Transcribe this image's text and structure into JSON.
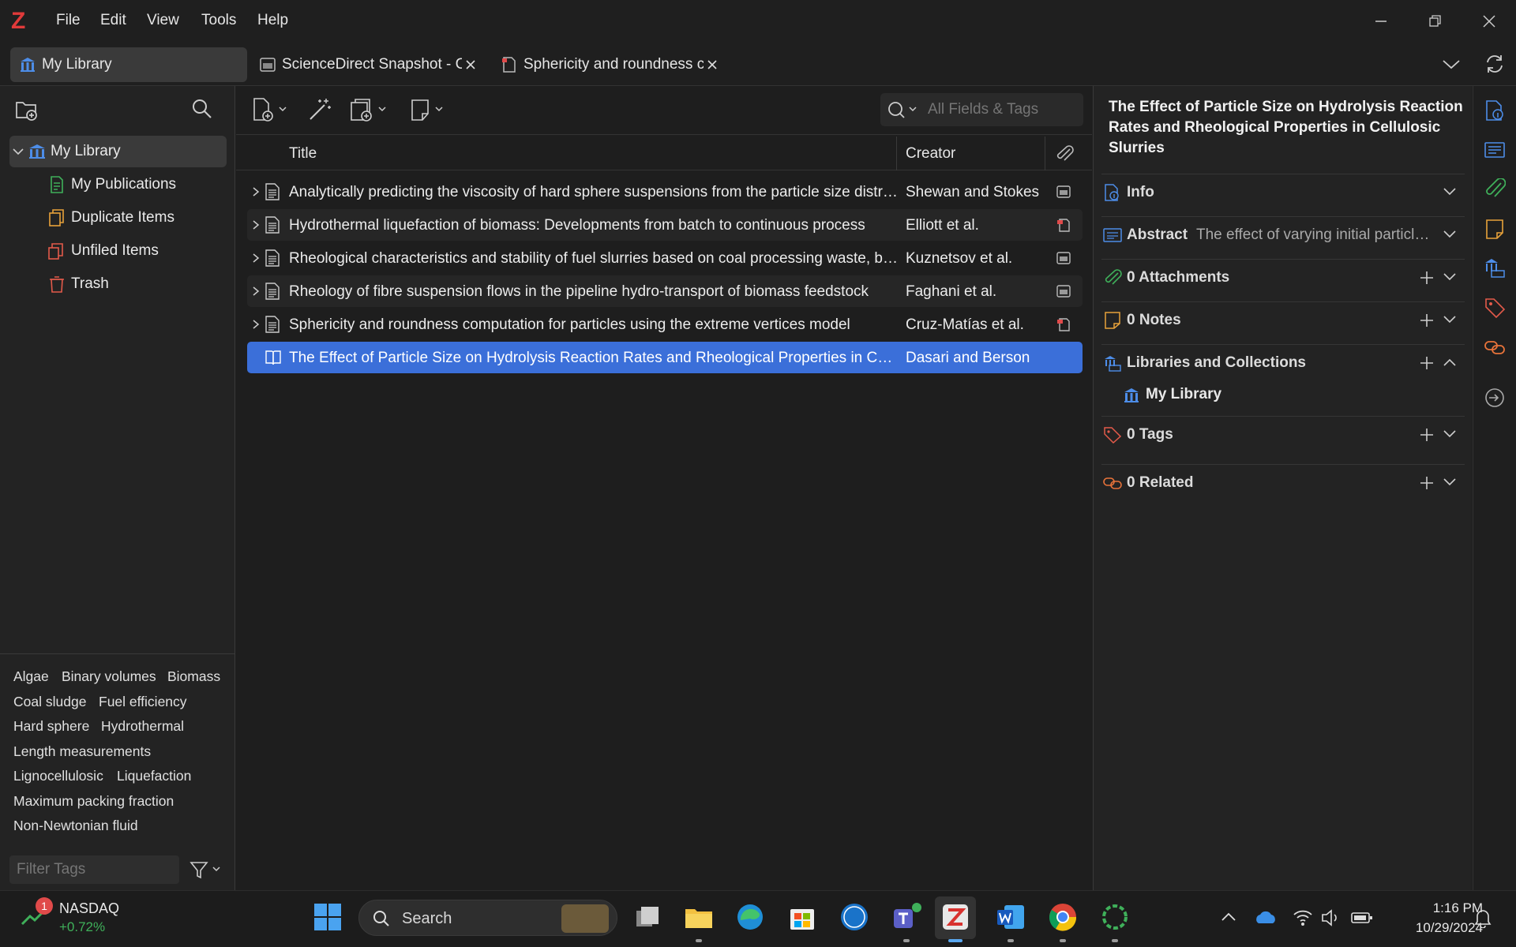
{
  "app": {
    "logo": "Z",
    "accent": "#3b6fd9"
  },
  "menu": {
    "file": "File",
    "edit": "Edit",
    "view": "View",
    "tools": "Tools",
    "help": "Help"
  },
  "tabs": [
    {
      "label": "My Library"
    },
    {
      "label": "ScienceDirect Snapshot - C"
    },
    {
      "label": "Sphericity and roundness c"
    }
  ],
  "collections": {
    "root": "My Library",
    "items": [
      {
        "label": "My Publications",
        "icon": "publications-icon"
      },
      {
        "label": "Duplicate Items",
        "icon": "duplicate-icon"
      },
      {
        "label": "Unfiled Items",
        "icon": "unfiled-icon"
      },
      {
        "label": "Trash",
        "icon": "trash-icon"
      }
    ]
  },
  "tags": [
    "Algae",
    "Binary volumes",
    "Biomass",
    "Coal sludge",
    "Fuel efficiency",
    "Hard sphere",
    "Hydrothermal",
    "Length measurements",
    "Lignocellulosic",
    "Liquefaction",
    "Maximum packing fraction",
    "Non-Newtonian fluid"
  ],
  "tag_filter": {
    "placeholder": "Filter Tags"
  },
  "search": {
    "placeholder": "All Fields & Tags"
  },
  "columns": {
    "title": "Title",
    "creator": "Creator"
  },
  "rows": [
    {
      "title": "Analytically predicting the viscosity of hard sphere suspensions from the particle size distribution",
      "creator": "Shewan and Stokes",
      "attachment": "snapshot"
    },
    {
      "title": "Hydrothermal liquefaction of biomass: Developments from batch to continuous process",
      "creator": "Elliott et al.",
      "attachment": "pdf"
    },
    {
      "title": "Rheological characteristics and stability of fuel slurries based on coal processing waste, biomass and used oil",
      "creator": "Kuznetsov et al.",
      "attachment": "snapshot"
    },
    {
      "title": "Rheology of fibre suspension flows in the pipeline hydro-transport of biomass feedstock",
      "creator": "Faghani et al.",
      "attachment": "snapshot"
    },
    {
      "title": "Sphericity and roundness computation for particles using the extreme vertices model",
      "creator": "Cruz-Matías et al.",
      "attachment": "pdf"
    },
    {
      "title": "The Effect of Particle Size on Hydrolysis Reaction Rates and Rheological Properties in Cellulosic Slurries",
      "creator": "Dasari and Berson",
      "attachment": "",
      "selected": true
    }
  ],
  "item_pane": {
    "title": "The Effect of Particle Size on Hydrolysis Reaction Rates and Rheological Properties in Cellulosic Slurries",
    "info": "Info",
    "abstract_label": "Abstract",
    "abstract_text": "The effect of varying initial particle size on enzymatic hydrolysis",
    "attachments": "0 Attachments",
    "notes": "0 Notes",
    "libraries": "Libraries and Collections",
    "library_entry": "My Library",
    "tags": "0 Tags",
    "related": "0 Related"
  },
  "taskbar": {
    "stock_name": "NASDAQ",
    "stock_change": "+0.72%",
    "stock_badge": "1",
    "search": "Search",
    "time": "1:16 PM",
    "date": "10/29/2024"
  }
}
